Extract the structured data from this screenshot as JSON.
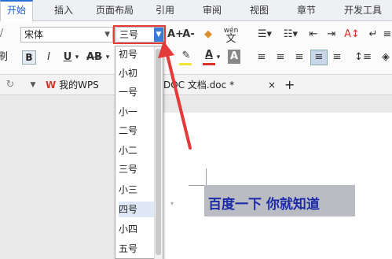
{
  "tabs": [
    "开始",
    "插入",
    "页面布局",
    "引用",
    "审阅",
    "视图",
    "章节",
    "开发工具"
  ],
  "ribbon": {
    "font_name": "宋体",
    "font_size": "三号",
    "font_grow": "A+",
    "font_shrink": "A-",
    "bold": "B",
    "italic": "I",
    "underline": "U",
    "strike": "AB",
    "text_color_icon": "A",
    "char_shading": "A",
    "phonetic": "wén",
    "left_edge": "刷"
  },
  "doc_tabs": {
    "my_wps": "我的WPS",
    "file": "DOC 文档.doc *",
    "close": "×",
    "add": "+"
  },
  "font_size_options": [
    "初号",
    "小初",
    "一号",
    "小一",
    "二号",
    "小二",
    "三号",
    "小三",
    "四号",
    "小四",
    "五号"
  ],
  "selected_option": "四号",
  "document_text": "百度一下 你就知道",
  "colors": {
    "accent": "#2b6fd6",
    "annotation": "#e53a3a",
    "wps_red": "#d9342b",
    "doc_text": "#1c2aa8"
  }
}
